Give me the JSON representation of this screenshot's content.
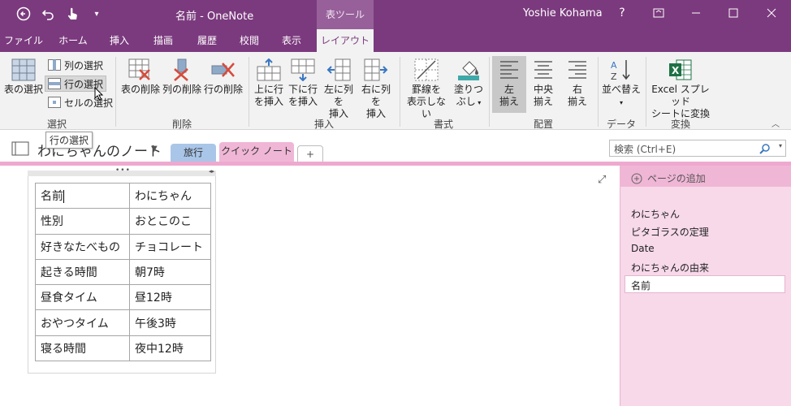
{
  "titlebar": {
    "title": "名前 - OneNote",
    "context_tab": "表ツール",
    "user": "Yoshie Kohama",
    "help": "?"
  },
  "ribbon_tabs": [
    "ファイル",
    "ホーム",
    "挿入",
    "描画",
    "履歴",
    "校閲",
    "表示",
    "レイアウト"
  ],
  "ribbon": {
    "select_group": {
      "label": "選択",
      "table_select": "表の選択",
      "col_select": "列の選択",
      "row_select": "行の選択",
      "cell_select": "セルの選択"
    },
    "delete_group": {
      "label": "削除",
      "table_delete": "表の削除",
      "col_delete": "列の削除",
      "row_delete": "行の削除"
    },
    "insert_group": {
      "label": "挿入",
      "above": [
        "上に行",
        "を挿入"
      ],
      "below": [
        "下に行",
        "を挿入"
      ],
      "left": [
        "左に列を",
        "挿入"
      ],
      "right": [
        "右に列を",
        "挿入"
      ]
    },
    "format_group": {
      "label": "書式",
      "hide_borders": [
        "罫線を",
        "表示しない"
      ],
      "shading": [
        "塗りつ",
        "ぶし"
      ]
    },
    "align_group": {
      "label": "配置",
      "left": [
        "左",
        "揃え"
      ],
      "center": [
        "中央",
        "揃え"
      ],
      "right": [
        "右",
        "揃え"
      ]
    },
    "data_group": {
      "label": "データ",
      "sort": "並べ替え"
    },
    "convert_group": {
      "label": "変換",
      "excel": [
        "Excel スプレッド",
        "シートに変換"
      ]
    },
    "tooltip": "行の選択"
  },
  "notebook": {
    "name": "わにちゃんのノート",
    "sections": [
      "旅行",
      "クイック ノート"
    ],
    "add_section": "+",
    "search_placeholder": "検索 (Ctrl+E)"
  },
  "table_rows": [
    [
      "名前",
      "わにちゃん"
    ],
    [
      "性別",
      "おとこのこ"
    ],
    [
      "好きなたべもの",
      "チョコレート"
    ],
    [
      "起きる時間",
      "朝7時"
    ],
    [
      "昼食タイム",
      "昼12時"
    ],
    [
      "おやつタイム",
      "午後3時"
    ],
    [
      "寝る時間",
      "夜中12時"
    ]
  ],
  "pages": {
    "add_page": "ページの追加",
    "items": [
      "わにちゃん",
      "ピタゴラスの定理",
      "Date",
      "わにちゃんの由来",
      "名前"
    ]
  },
  "colors": {
    "brand": "#7B3A7E",
    "section_quick": "#F0B6D6",
    "section_travel": "#A9C6E8"
  }
}
